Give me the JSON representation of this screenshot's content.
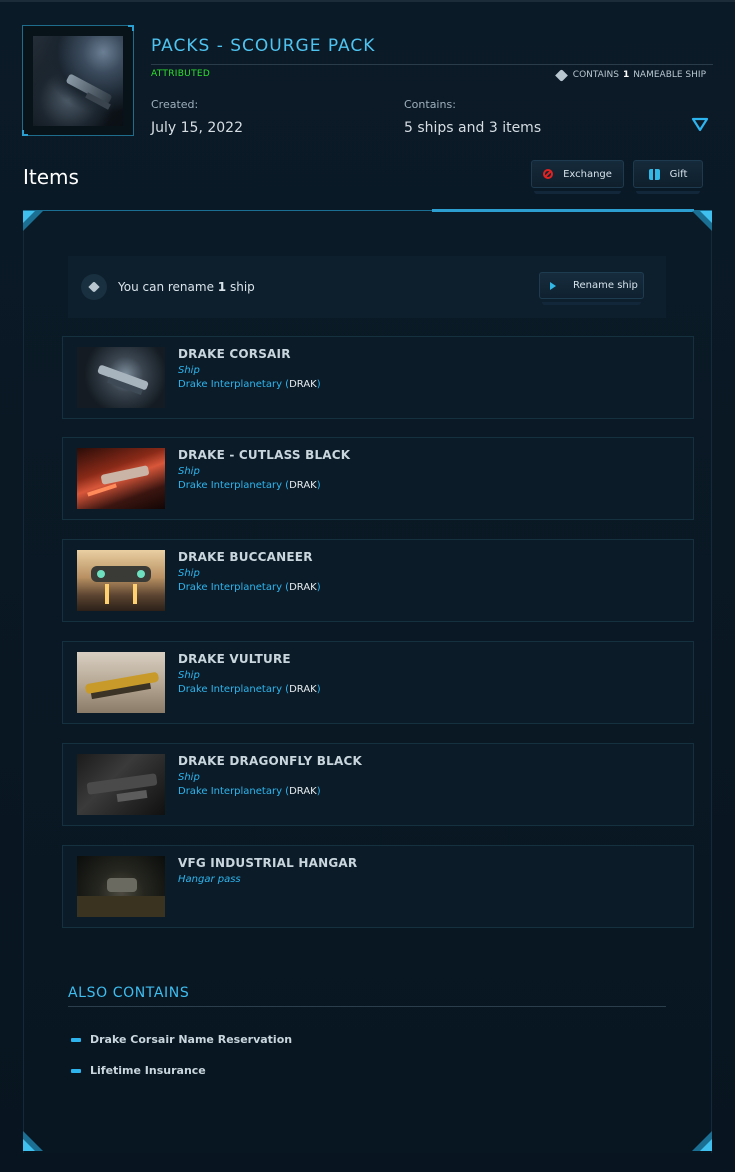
{
  "pack": {
    "title": "PACKS - SCOURGE PACK",
    "status": "ATTRIBUTED",
    "nameable_prefix": "CONTAINS",
    "nameable_count": "1",
    "nameable_suffix": "NAMEABLE SHIP",
    "created_label": "Created:",
    "created_value": "July 15, 2022",
    "contains_label": "Contains:",
    "contains_value": "5 ships and 3 items"
  },
  "section": {
    "title": "Items",
    "exchange_label": "Exchange",
    "gift_label": "Gift"
  },
  "rename": {
    "text_prefix": "You can rename",
    "count": "1",
    "text_suffix": "ship",
    "button_label": "Rename ship"
  },
  "items": [
    {
      "name": "DRAKE CORSAIR",
      "type": "Ship",
      "maker": "Drake Interplanetary",
      "code": "DRAK"
    },
    {
      "name": "DRAKE - CUTLASS BLACK",
      "type": "Ship",
      "maker": "Drake Interplanetary",
      "code": "DRAK"
    },
    {
      "name": "DRAKE BUCCANEER",
      "type": "Ship",
      "maker": "Drake Interplanetary",
      "code": "DRAK"
    },
    {
      "name": "DRAKE VULTURE",
      "type": "Ship",
      "maker": "Drake Interplanetary",
      "code": "DRAK"
    },
    {
      "name": "DRAKE DRAGONFLY BLACK",
      "type": "Ship",
      "maker": "Drake Interplanetary",
      "code": "DRAK"
    },
    {
      "name": "VFG INDUSTRIAL HANGAR",
      "type": "Hangar pass"
    }
  ],
  "also_contains": {
    "title": "ALSO CONTAINS",
    "items": [
      "Drake Corsair Name Reservation",
      "Lifetime Insurance"
    ]
  },
  "icons": {
    "tag": "tag-icon",
    "expand": "chevron-down-icon",
    "exchange": "exchange-icon",
    "gift": "gift-icon",
    "rename_play": "play-icon"
  },
  "colors": {
    "accent": "#4fc3f0",
    "link": "#2db4ee",
    "status_green": "#2ee02e",
    "exchange_red": "#e02222"
  }
}
